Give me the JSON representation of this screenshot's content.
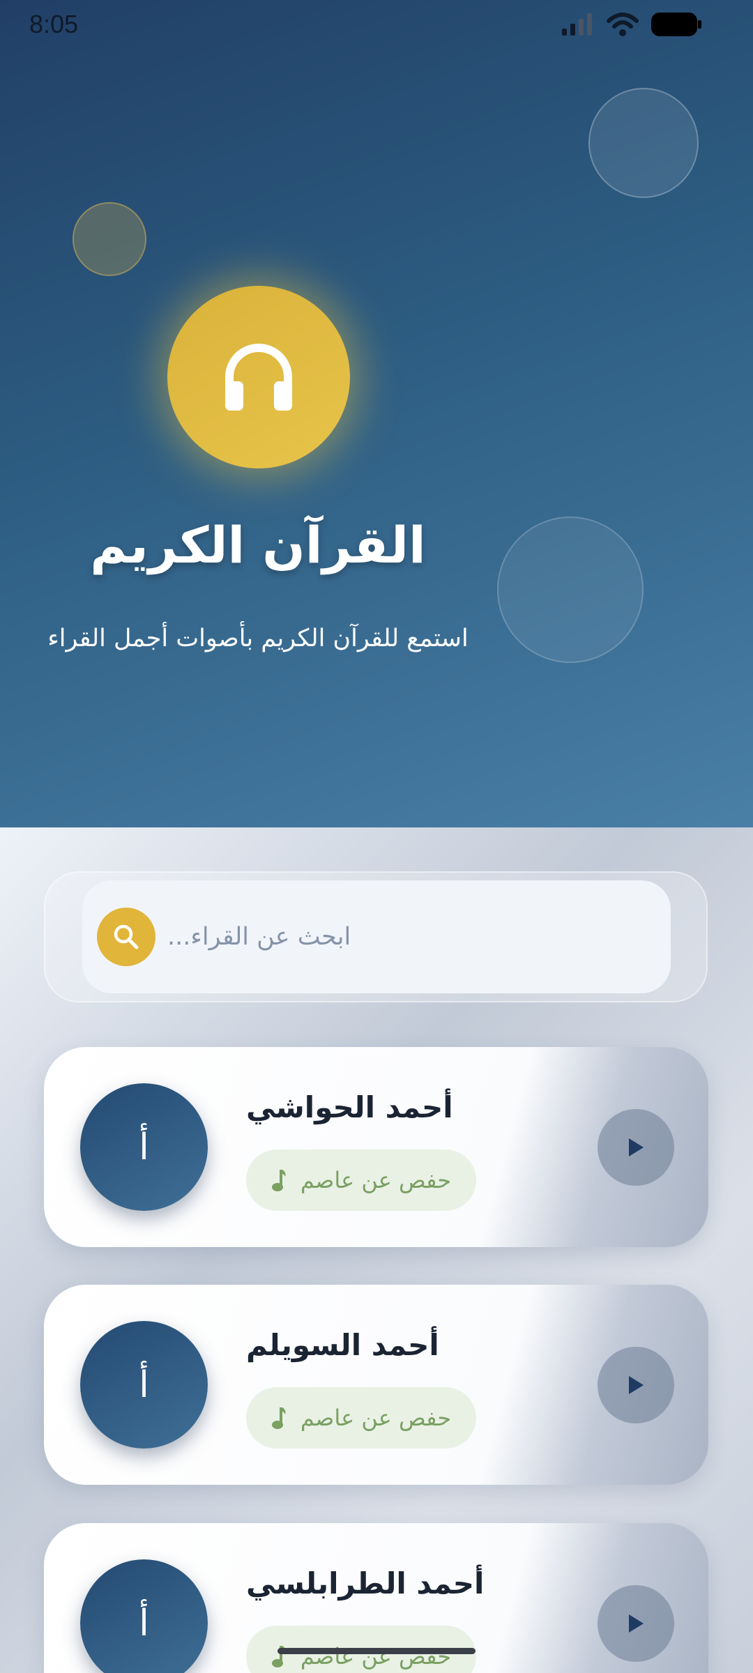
{
  "status_bar": {
    "time": "8:05"
  },
  "hero": {
    "title": "القرآن الكريم",
    "subtitle": "استمع للقرآن الكريم بأصوات أجمل القراء",
    "logo_icon": "headphones-icon"
  },
  "search": {
    "placeholder": "...ابحث عن القراء",
    "value": "",
    "icon": "search-icon"
  },
  "reciters": [
    {
      "initial": "أ",
      "name": "أحمد الحواشي",
      "riwaya": "حفص عن عاصم"
    },
    {
      "initial": "أ",
      "name": "أحمد السويلم",
      "riwaya": "حفص عن عاصم"
    },
    {
      "initial": "أ",
      "name": "أحمد الطرابلسي",
      "riwaya": "حفص عن عاصم"
    }
  ],
  "colors": {
    "accent_gold": "#e1b43a",
    "hero_dark": "#213f66",
    "hero_light": "#4a7fa6",
    "riwaya_green": "#7aa062"
  }
}
